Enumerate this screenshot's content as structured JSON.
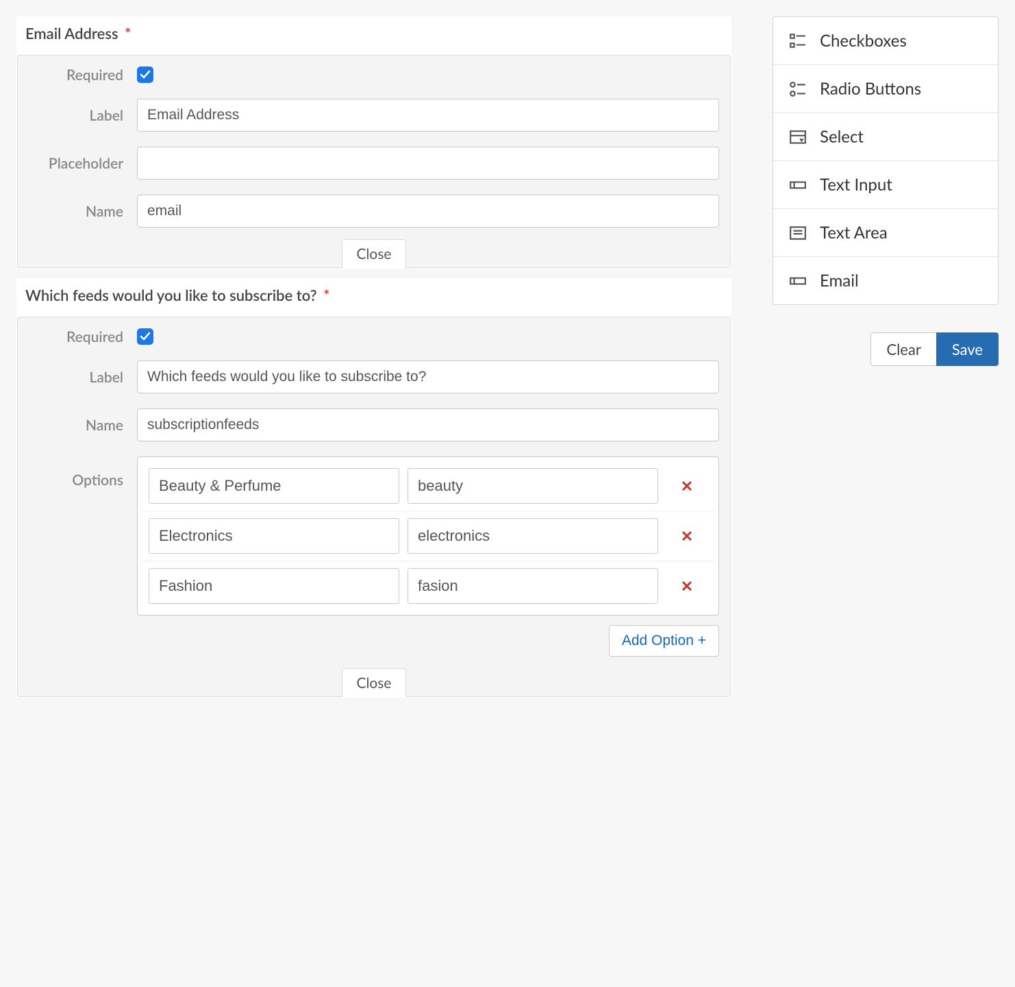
{
  "fields": [
    {
      "title": "Email Address",
      "required": true,
      "required_label": "Required",
      "label_label": "Label",
      "label_value": "Email Address",
      "placeholder_label": "Placeholder",
      "placeholder_value": "",
      "name_label": "Name",
      "name_value": "email",
      "close_label": "Close"
    },
    {
      "title": "Which feeds would you like to subscribe to?",
      "required": true,
      "required_label": "Required",
      "label_label": "Label",
      "label_value": "Which feeds would you like to subscribe to?",
      "name_label": "Name",
      "name_value": "subscriptionfeeds",
      "options_label": "Options",
      "options": [
        {
          "label": "Beauty & Perfume",
          "value": "beauty"
        },
        {
          "label": "Electronics",
          "value": "electronics"
        },
        {
          "label": "Fashion",
          "value": "fasion"
        }
      ],
      "add_option_label": "Add Option +",
      "close_label": "Close"
    }
  ],
  "palette": [
    {
      "icon": "checkboxes",
      "label": "Checkboxes"
    },
    {
      "icon": "radio",
      "label": "Radio Buttons"
    },
    {
      "icon": "select",
      "label": "Select"
    },
    {
      "icon": "text",
      "label": "Text Input"
    },
    {
      "icon": "textarea",
      "label": "Text Area"
    },
    {
      "icon": "email",
      "label": "Email"
    }
  ],
  "buttons": {
    "clear": "Clear",
    "save": "Save"
  }
}
